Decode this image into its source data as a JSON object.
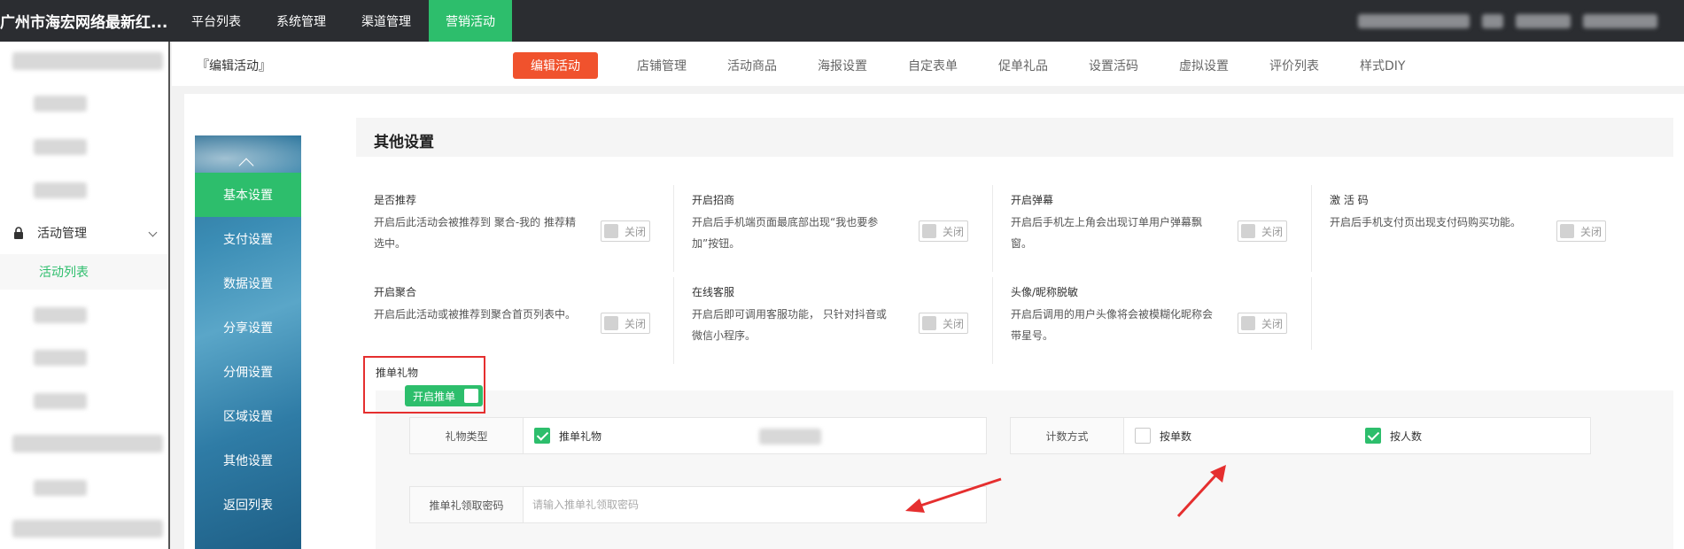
{
  "header": {
    "brand": "广州市海宏网络最新红...",
    "nav": [
      {
        "label": "平台列表"
      },
      {
        "label": "系统管理"
      },
      {
        "label": "渠道管理"
      },
      {
        "label": "营销活动"
      }
    ]
  },
  "sidebar": {
    "group_label": "活动管理",
    "active_item": "活动列表"
  },
  "breadcrumb": "『编辑活动』",
  "tabs": [
    {
      "label": "编辑活动"
    },
    {
      "label": "店铺管理"
    },
    {
      "label": "活动商品"
    },
    {
      "label": "海报设置"
    },
    {
      "label": "自定表单"
    },
    {
      "label": "促单礼品"
    },
    {
      "label": "设置活码"
    },
    {
      "label": "虚拟设置"
    },
    {
      "label": "评价列表"
    },
    {
      "label": "样式DIY"
    }
  ],
  "side_menu": [
    {
      "label": "基本设置"
    },
    {
      "label": "支付设置"
    },
    {
      "label": "数据设置"
    },
    {
      "label": "分享设置"
    },
    {
      "label": "分佣设置"
    },
    {
      "label": "区域设置"
    },
    {
      "label": "其他设置"
    },
    {
      "label": "返回列表"
    }
  ],
  "section_title": "其他设置",
  "options": [
    {
      "title": "是否推荐",
      "desc": "开启后此活动会被推荐到 聚合-我的 推荐精选中。",
      "state": "关闭"
    },
    {
      "title": "开启招商",
      "desc": "开启后手机端页面最底部出现“我也要参加”按钮。",
      "state": "关闭"
    },
    {
      "title": "开启弹幕",
      "desc": "开启后手机左上角会出现订单用户弹幕飘窗。",
      "state": "关闭"
    },
    {
      "title": "激 活 码",
      "desc": "开启后手机支付页出现支付码购买功能。",
      "state": "关闭"
    },
    {
      "title": "开启聚合",
      "desc": "开启后此活动或被推荐到聚合首页列表中。",
      "state": "关闭"
    },
    {
      "title": "在线客服",
      "desc": "开启后即可调用客服功能， 只针对抖音或微信小程序。",
      "state": "关闭"
    },
    {
      "title": "头像/昵称脱敏",
      "desc": "开启后调用的用户头像将会被模糊化昵称会带星号。",
      "state": "关闭"
    }
  ],
  "gift": {
    "title": "推单礼物",
    "toggle_label": "开启推单",
    "type_label": "礼物类型",
    "type_option": "推单礼物",
    "count_label": "计数方式",
    "count_options": [
      {
        "label": "按单数",
        "checked": false
      },
      {
        "label": "按人数",
        "checked": true
      }
    ],
    "password_label": "推单礼领取密码",
    "password_placeholder": "请输入推单礼领取密码",
    "password_value": ""
  },
  "colors": {
    "accent_green": "#2dbe6c",
    "active_tab": "#f0522d",
    "highlight_red": "#e52f2f",
    "topbar": "#2b2d31"
  }
}
